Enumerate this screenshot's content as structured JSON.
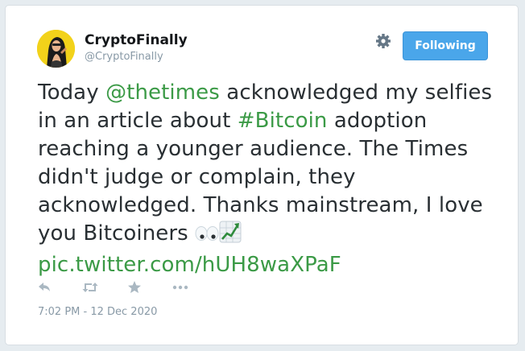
{
  "author": {
    "display_name": "CryptoFinally",
    "handle": "@CryptoFinally",
    "avatar_icon": "profile-photo"
  },
  "header": {
    "settings_icon": "gear-icon",
    "follow_button_label": "Following"
  },
  "tweet": {
    "text_before_mention": "Today ",
    "mention": "@thetimes",
    "text_after_mention": " acknowledged my selfies in an article about ",
    "hashtag": "#Bitcoin",
    "text_after_hashtag": " adoption reaching a younger audience. The Times didn't judge or complain, they acknowledged. Thanks mainstream, I love you Bitcoiners ",
    "emojis": [
      "eyes-emoji",
      "chart-increasing-emoji"
    ],
    "link": "pic.twitter.com/hUH8waXPaF"
  },
  "actions": [
    "reply-icon",
    "retweet-icon",
    "like-icon",
    "more-icon"
  ],
  "timestamp": "7:02 PM - 12 Dec 2020",
  "colors": {
    "link_green": "#3b9a46",
    "button_blue": "#4aa6ea",
    "text_dark": "#292f33",
    "muted_gray": "#8899a6",
    "avatar_yellow": "#f2d21a"
  }
}
